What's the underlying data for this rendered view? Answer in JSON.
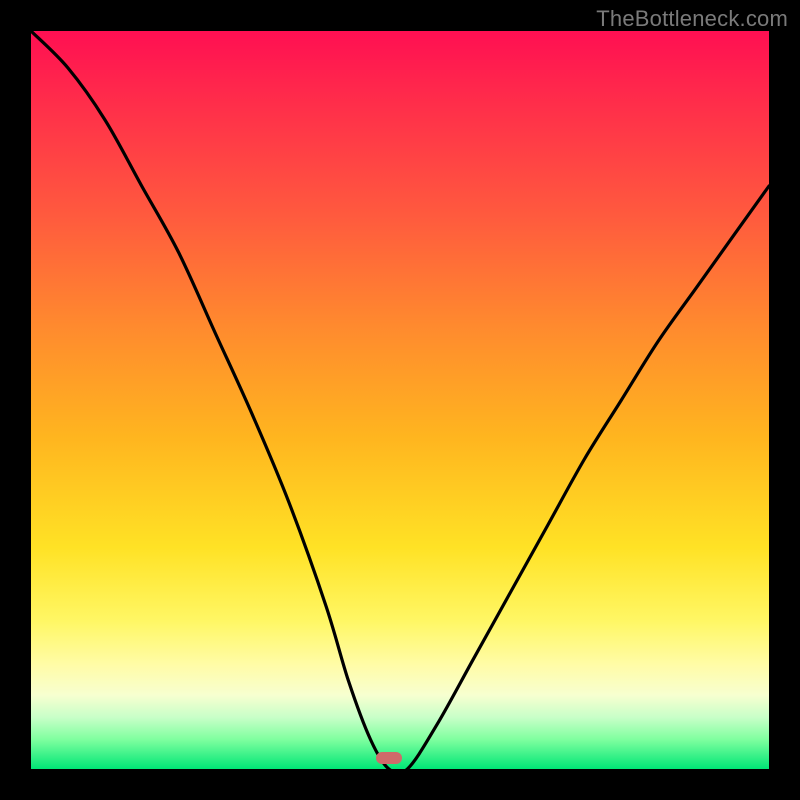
{
  "watermark": {
    "text": "TheBottleneck.com"
  },
  "marker": {
    "color": "#cf6a6a",
    "x_frac": 0.485,
    "y_frac": 0.985
  },
  "chart_data": {
    "type": "line",
    "title": "",
    "xlabel": "",
    "ylabel": "",
    "xlim": [
      0,
      1
    ],
    "ylim": [
      0,
      1
    ],
    "grid": false,
    "legend": false,
    "series": [
      {
        "name": "bottleneck-curve",
        "x": [
          0.0,
          0.05,
          0.1,
          0.15,
          0.2,
          0.25,
          0.3,
          0.35,
          0.4,
          0.43,
          0.46,
          0.485,
          0.51,
          0.55,
          0.6,
          0.65,
          0.7,
          0.75,
          0.8,
          0.85,
          0.9,
          0.95,
          1.0
        ],
        "y": [
          1.0,
          0.95,
          0.88,
          0.79,
          0.7,
          0.59,
          0.48,
          0.36,
          0.22,
          0.12,
          0.04,
          0.0,
          0.0,
          0.06,
          0.15,
          0.24,
          0.33,
          0.42,
          0.5,
          0.58,
          0.65,
          0.72,
          0.79
        ]
      }
    ],
    "annotations": [
      {
        "type": "pill-marker",
        "x": 0.485,
        "y": 0.015,
        "label": ""
      }
    ],
    "gradient_stops": [
      {
        "pos": 0.0,
        "color": "#ff0f52"
      },
      {
        "pos": 0.1,
        "color": "#ff2e4a"
      },
      {
        "pos": 0.25,
        "color": "#ff5a3e"
      },
      {
        "pos": 0.4,
        "color": "#ff8a2e"
      },
      {
        "pos": 0.55,
        "color": "#ffb51f"
      },
      {
        "pos": 0.7,
        "color": "#ffe225"
      },
      {
        "pos": 0.8,
        "color": "#fff765"
      },
      {
        "pos": 0.86,
        "color": "#fffca8"
      },
      {
        "pos": 0.9,
        "color": "#f7ffd0"
      },
      {
        "pos": 0.93,
        "color": "#c8ffc8"
      },
      {
        "pos": 0.96,
        "color": "#7fff9f"
      },
      {
        "pos": 1.0,
        "color": "#00e676"
      }
    ]
  }
}
